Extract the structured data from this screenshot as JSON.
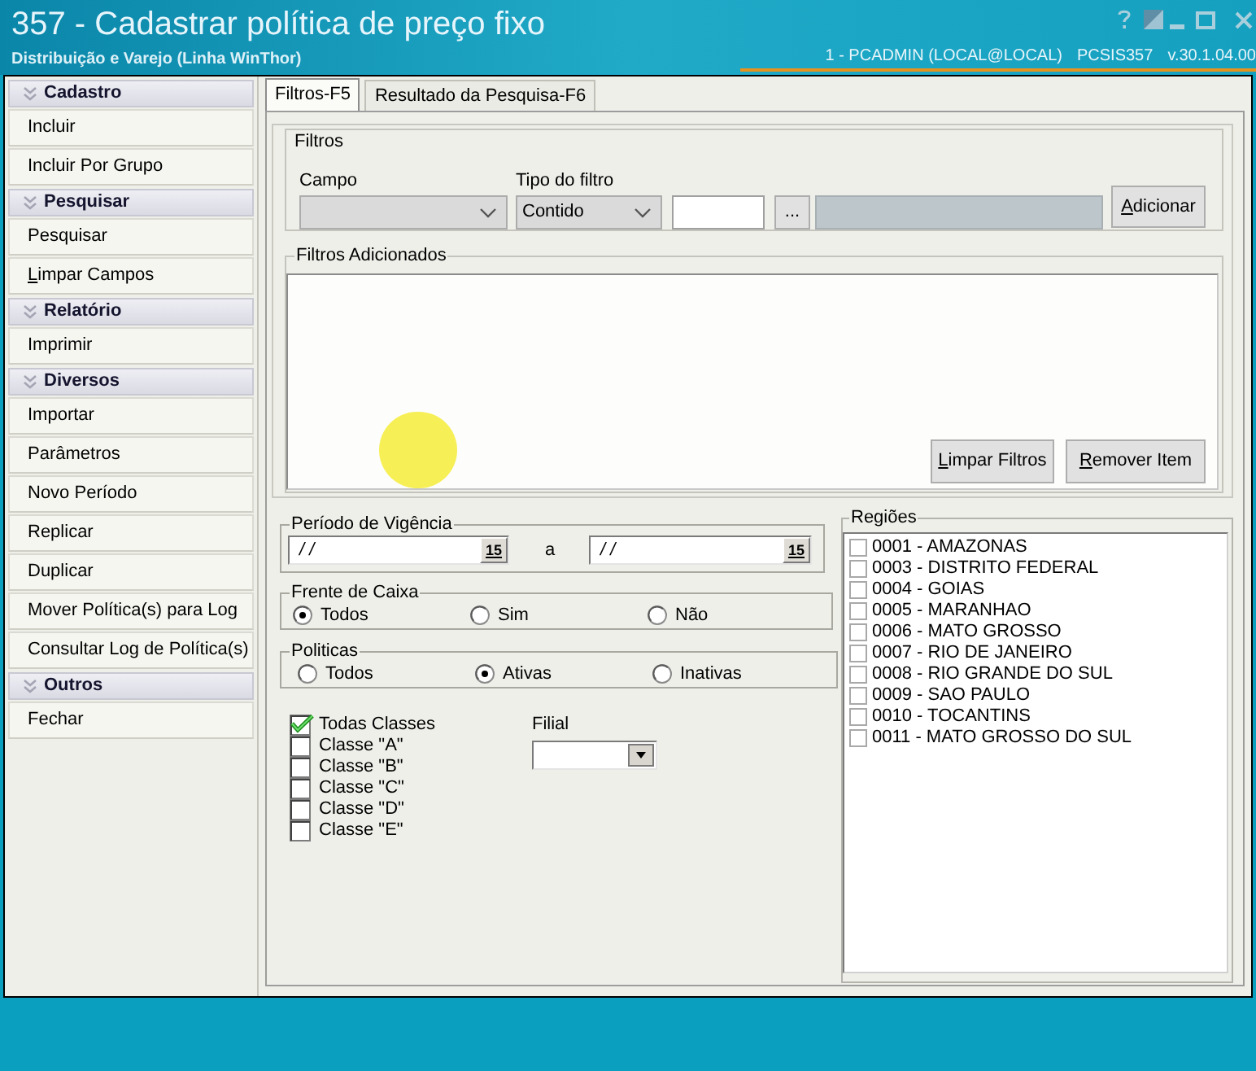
{
  "window": {
    "title": "357 - Cadastrar política de preço fixo",
    "subtitle": "Distribuição e Varejo (Linha WinThor)",
    "session": "1 - PCADMIN (LOCAL@LOCAL)",
    "program": "PCSIS357",
    "version": "v.30.1.04.00"
  },
  "sidebar": {
    "sections": [
      {
        "title": "Cadastro",
        "items": [
          {
            "label": "Incluir",
            "access_key": false
          },
          {
            "label": "Incluir Por Grupo",
            "access_key": false
          }
        ]
      },
      {
        "title": "Pesquisar",
        "items": [
          {
            "label": "Pesquisar",
            "access_key": false
          },
          {
            "label": "Limpar Campos",
            "access_key": true
          }
        ]
      },
      {
        "title": "Relatório",
        "items": [
          {
            "label": "Imprimir",
            "access_key": false
          }
        ]
      },
      {
        "title": "Diversos",
        "items": [
          {
            "label": "Importar",
            "access_key": false
          },
          {
            "label": "Parâmetros",
            "access_key": false
          },
          {
            "label": "Novo Período",
            "access_key": false
          },
          {
            "label": "Replicar",
            "access_key": false
          },
          {
            "label": "Duplicar",
            "access_key": false
          },
          {
            "label": "Mover Política(s) para Log",
            "access_key": false
          },
          {
            "label": "Consultar Log de Política(s)",
            "access_key": false
          }
        ]
      },
      {
        "title": "Outros",
        "items": [
          {
            "label": "Fechar",
            "access_key": false
          }
        ]
      }
    ]
  },
  "tabs": [
    {
      "label": "Filtros-F5",
      "selected": true
    },
    {
      "label": "Resultado da Pesquisa-F6",
      "selected": false
    }
  ],
  "filters": {
    "title": "Filtros",
    "field": {
      "label": "Campo"
    },
    "filter_type": {
      "label": "Tipo do filtro",
      "value": "Contido"
    },
    "value_input": {
      "disabled": false
    },
    "lookup_button": "...",
    "description_input": {
      "disabled": true
    },
    "add_button": {
      "label": "Adicionar",
      "access_key": true
    }
  },
  "added_filters": {
    "title": "Filtros Adicionados",
    "buttons": [
      {
        "label": "Limpar Filtros",
        "access_key": true
      },
      {
        "label": "Remover Item",
        "access_key": true
      }
    ]
  },
  "validity": {
    "title": "Período de Vigência",
    "start": {
      "value": "/ /",
      "calendar": "15"
    },
    "separator": "a",
    "end": {
      "value": "/ /",
      "calendar": "15"
    }
  },
  "checkout": {
    "title": "Frente de Caixa",
    "options": [
      {
        "label": "Todos",
        "selected": true
      },
      {
        "label": "Sim",
        "selected": false
      },
      {
        "label": "Não",
        "selected": false
      }
    ]
  },
  "policies": {
    "title": "Politicas",
    "options": [
      {
        "label": "Todos",
        "selected": false
      },
      {
        "label": "Ativas",
        "selected": true
      },
      {
        "label": "Inativas",
        "selected": false
      }
    ]
  },
  "classes": [
    {
      "label": "Todas Classes",
      "checked": true
    },
    {
      "label": "Classe \"A\"",
      "checked": false
    },
    {
      "label": "Classe \"B\"",
      "checked": false
    },
    {
      "label": "Classe \"C\"",
      "checked": false
    },
    {
      "label": "Classe \"D\"",
      "checked": false
    },
    {
      "label": "Classe \"E\"",
      "checked": false
    }
  ],
  "branch": {
    "label": "Filial"
  },
  "regions": {
    "title": "Regiões",
    "items": [
      {
        "label": "0001 - AMAZONAS",
        "checked": false
      },
      {
        "label": "0003 - DISTRITO FEDERAL",
        "checked": false
      },
      {
        "label": "0004 - GOIAS",
        "checked": false
      },
      {
        "label": "0005 - MARANHAO",
        "checked": false
      },
      {
        "label": "0006 - MATO GROSSO",
        "checked": false
      },
      {
        "label": "0007 - RIO DE JANEIRO",
        "checked": false
      },
      {
        "label": "0008 - RIO GRANDE DO SUL",
        "checked": false
      },
      {
        "label": "0009 - SAO PAULO",
        "checked": false
      },
      {
        "label": "0010 - TOCANTINS",
        "checked": false
      },
      {
        "label": "0011 - MATO GROSSO DO SUL",
        "checked": false
      }
    ]
  }
}
